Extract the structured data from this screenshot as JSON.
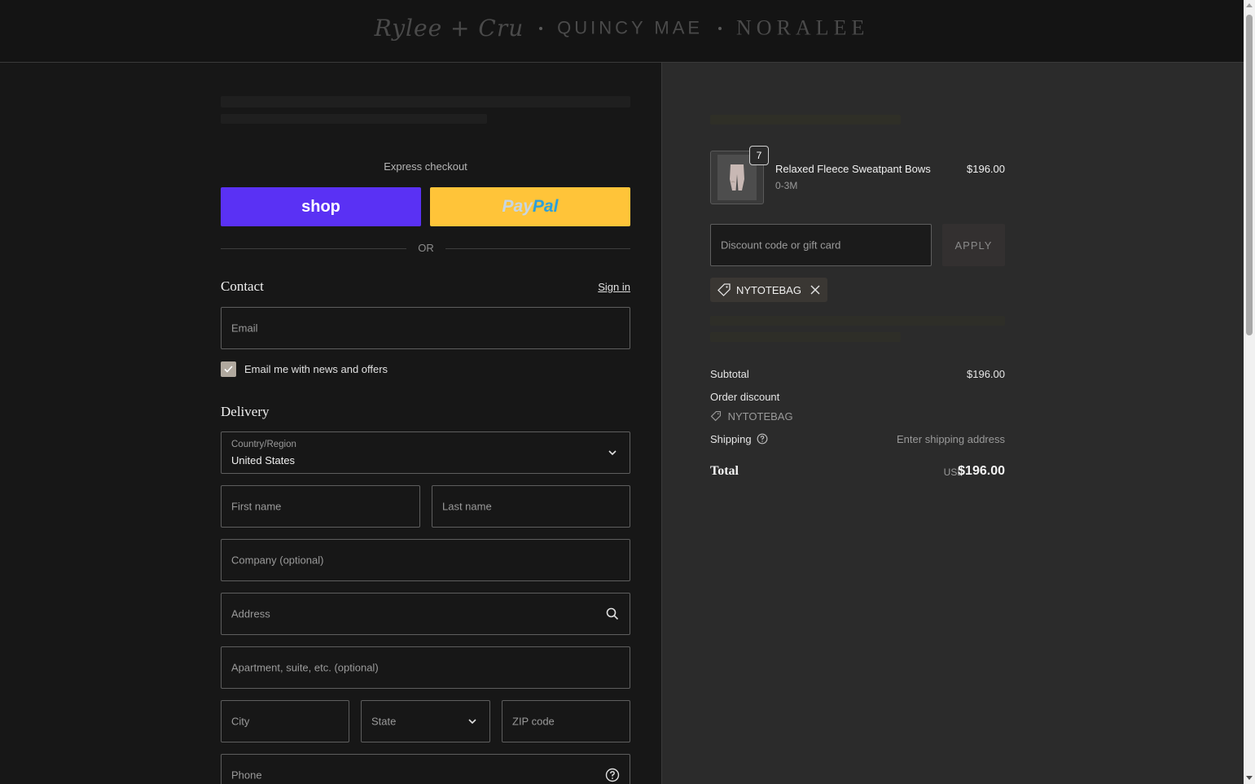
{
  "header": {
    "brands": [
      "Rylee + Cru",
      "QUINCY MAE",
      "NORALEE"
    ]
  },
  "express": {
    "label": "Express checkout",
    "shop_label": "shop",
    "paypal_part1": "Pay",
    "paypal_part2": "Pal",
    "or_label": "OR"
  },
  "contact": {
    "title": "Contact",
    "signin_label": "Sign in",
    "email_placeholder": "Email",
    "newsletter_label": "Email me with news and offers",
    "newsletter_checked": true
  },
  "delivery": {
    "title": "Delivery",
    "country_label": "Country/Region",
    "country_value": "United States",
    "first_name": "First name",
    "last_name": "Last name",
    "company": "Company (optional)",
    "address": "Address",
    "apartment": "Apartment, suite, etc. (optional)",
    "city": "City",
    "state": "State",
    "zip": "ZIP code",
    "phone": "Phone"
  },
  "cart": {
    "item": {
      "name": "Relaxed Fleece Sweatpant Bows",
      "variant": "0-3M",
      "quantity": "7",
      "price": "$196.00"
    },
    "discount_placeholder": "Discount code or gift card",
    "apply_label": "APPLY",
    "applied_code": "NYTOTEBAG"
  },
  "summary": {
    "subtotal_label": "Subtotal",
    "subtotal_value": "$196.00",
    "order_discount_label": "Order discount",
    "order_discount_code": "NYTOTEBAG",
    "shipping_label": "Shipping",
    "shipping_value": "Enter shipping address",
    "total_label": "Total",
    "total_currency": "USD",
    "total_value": "$196.00"
  },
  "colors": {
    "shop_pay": "#5a31f4",
    "paypal": "#ffc439"
  }
}
